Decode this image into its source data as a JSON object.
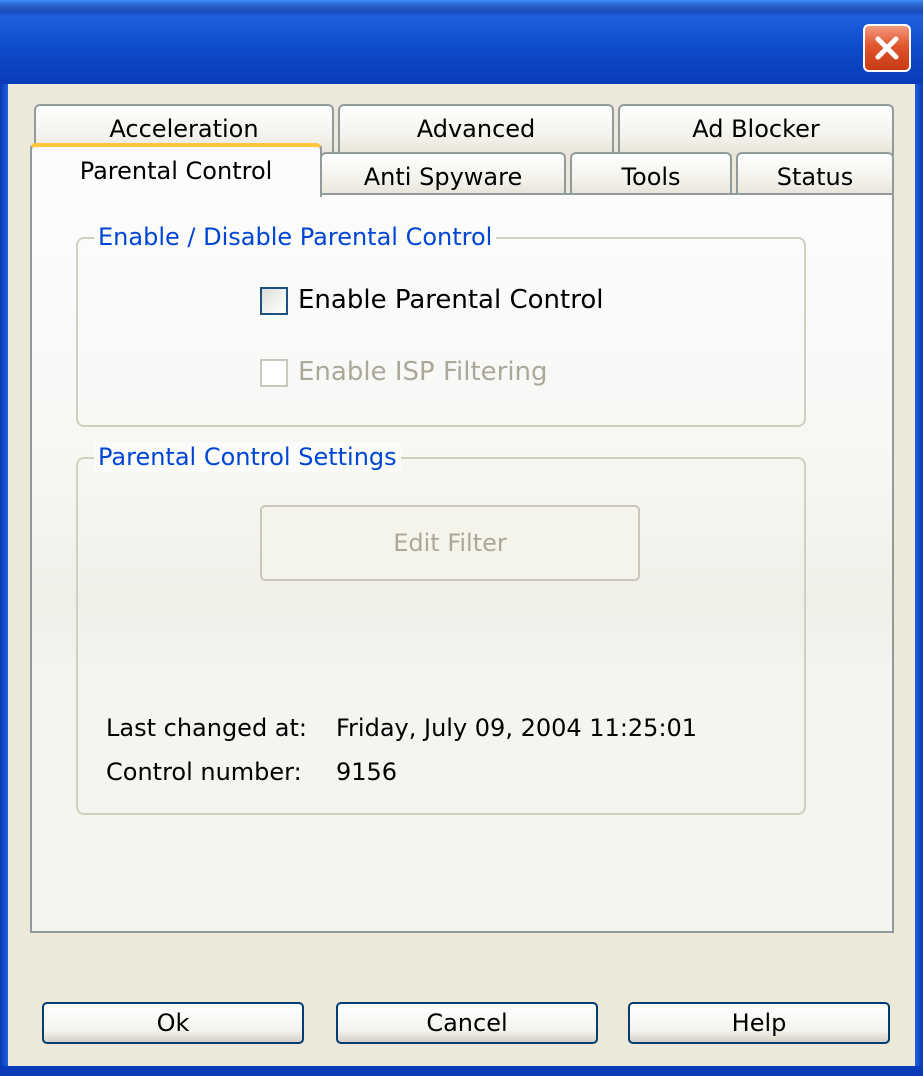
{
  "window": {
    "close_icon": "close-icon",
    "close_color": "#e0552d"
  },
  "tabs": {
    "row_back": [
      {
        "label": "Acceleration"
      },
      {
        "label": "Advanced"
      },
      {
        "label": "Ad Blocker"
      }
    ],
    "row_front": [
      {
        "label": "Parental Control",
        "active": true
      },
      {
        "label": "Anti Spyware"
      },
      {
        "label": "Tools"
      },
      {
        "label": "Status"
      }
    ]
  },
  "enable_group": {
    "title": "Enable / Disable Parental Control",
    "enable_parental_control": {
      "label": "Enable Parental Control",
      "checked": false,
      "enabled": true
    },
    "enable_isp_filtering": {
      "label": "Enable ISP Filtering",
      "checked": false,
      "enabled": false
    }
  },
  "settings_group": {
    "title": "Parental Control Settings",
    "edit_filter_label": "Edit Filter",
    "last_changed_label": "Last changed at:",
    "last_changed_value": "Friday, July 09, 2004 11:25:01",
    "control_number_label": "Control number:",
    "control_number_value": "9156"
  },
  "buttons": {
    "ok": "Ok",
    "cancel": "Cancel",
    "help": "Help"
  },
  "colors": {
    "accent_blue": "#0046d5",
    "active_tab_highlight": "#ffc83c",
    "titlebar_blue": "#0d4ccc"
  }
}
